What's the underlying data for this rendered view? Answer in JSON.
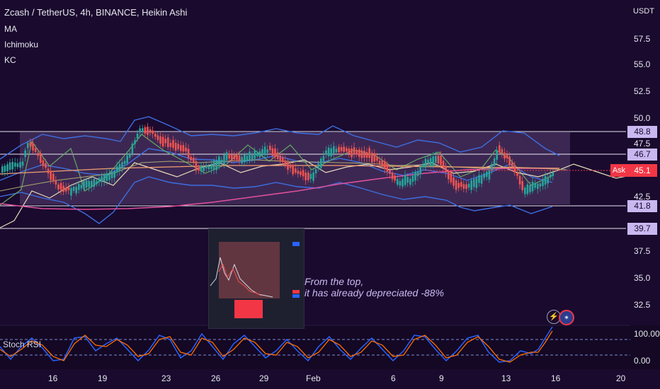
{
  "header": {
    "symbol_line": "Zcash / TetherUS, 4h, BINANCE, Heikin Ashi",
    "indicators": [
      "MA",
      "Ichimoku",
      "KC"
    ]
  },
  "price_axis": {
    "currency": "USDT",
    "ticks": [
      "57.5",
      "55.0",
      "52.5",
      "50.0",
      "47.5",
      "45.0",
      "42.5",
      "37.5",
      "35.0",
      "32.5"
    ]
  },
  "price_levels": [
    {
      "label": "48.8",
      "value": 48.8
    },
    {
      "label": "46.7",
      "value": 46.7
    },
    {
      "label": "41.8",
      "value": 41.8
    },
    {
      "label": "39.7",
      "value": 39.7
    }
  ],
  "ask": {
    "label": "Ask",
    "value": "45.1"
  },
  "annotation": {
    "line1": "From the top,",
    "line2": "it has already depreciated -88%"
  },
  "stoch_rsi": {
    "label": "Stoch RSI",
    "ticks": [
      "100.00",
      "0.00"
    ]
  },
  "time_axis": {
    "labels": [
      "16",
      "19",
      "23",
      "26",
      "29",
      "Feb",
      "6",
      "9",
      "13",
      "16",
      "20"
    ]
  },
  "colors": {
    "background": "#1a0a2e",
    "up_candle": "#26a69a",
    "down_candle": "#ef5350",
    "range_fill": "#5a3f72",
    "level_line": "#e8e8f0",
    "kc_band": "#3d6fe0",
    "ma_pink": "#e0509a",
    "ichimoku_green": "#63a863",
    "stoch_k": "#2962ff",
    "stoch_d": "#ff6d00",
    "ask_red": "#f23645",
    "level_box": "#c9b8f0"
  },
  "chart_data": {
    "type": "candlestick",
    "y_range": [
      30.6,
      59.6
    ],
    "level_values": [
      48.8,
      46.7,
      41.8,
      39.7
    ],
    "last_price": 45.1,
    "stoch_range": [
      0,
      100
    ]
  }
}
